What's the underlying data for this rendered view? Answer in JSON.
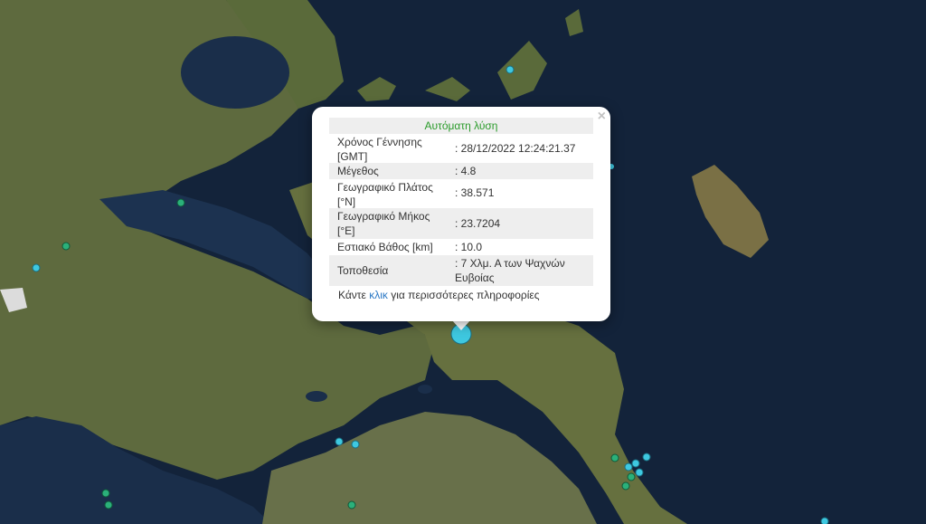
{
  "popup": {
    "title": "Αυτόματη λύση",
    "close_symbol": "×",
    "fields": [
      {
        "label": "Χρόνος Γέννησης [GMT]",
        "value": ": 28/12/2022 12:24:21.37"
      },
      {
        "label": "Μέγεθος",
        "value": ": 4.8"
      },
      {
        "label": "Γεωγραφικό Πλάτος [°N]",
        "value": ": 38.571"
      },
      {
        "label": "Γεωγραφικό Μήκος [°E]",
        "value": ": 23.7204"
      },
      {
        "label": "Εστιακό Βάθος [km]",
        "value": ": 10.0"
      },
      {
        "label": "Τοποθεσία",
        "value": ": 7 Χλμ. Α των Ψαχνών Ευβοίας"
      }
    ],
    "footer_prefix": "Κάντε ",
    "footer_link": "κλικ",
    "footer_suffix": " για περισσότερες πληροφορίες"
  },
  "colors": {
    "sea": "#13233a",
    "land": "#5e6a3e",
    "quake_recent": "#3ec8e0",
    "quake_older": "#2bb07a"
  },
  "icons": {
    "close": "close-icon",
    "quake": "earthquake-marker"
  }
}
